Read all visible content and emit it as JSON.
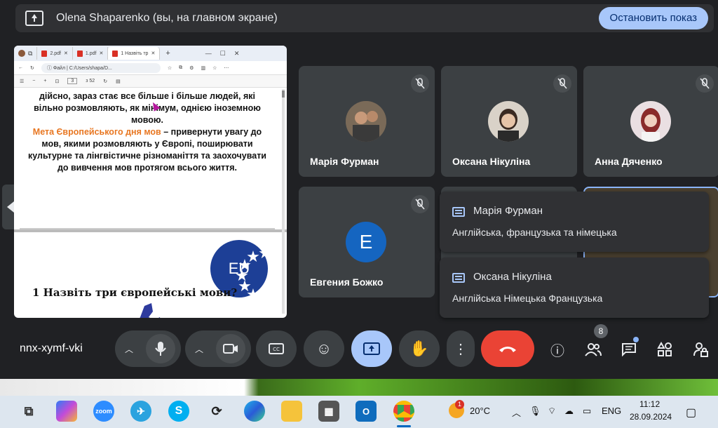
{
  "banner": {
    "title": "Olena Shaparenko (вы, на главном экране)",
    "stop_label": "Остановить показ"
  },
  "presentation": {
    "browser": {
      "tabs": [
        "2.pdf",
        "1.pdf",
        "1 Назвіть тр"
      ],
      "address_label": "Файл",
      "address_path": "C:/Users/shapa/D...",
      "page_current": "3",
      "page_total": "з 52"
    },
    "slide_text": {
      "line1": "дійсно, зараз стає все більше і більше людей, які",
      "line2": "вільно розмовляють, як мінімум, однією іноземною",
      "line3": "мовою.",
      "goal_orange": "Мета Європейського дня мов",
      "goal_rest1": " – привернути увагу до",
      "goal_rest2": "мов, якими розмовляють у Європі, поширювати",
      "goal_rest3": "культурне та лінгвістичне різноманіття та заохочувати",
      "goal_rest4": "до вивчення мов протягом всього життя."
    },
    "flag_text": "EU",
    "question": "1 Назвіть три європейські мови?"
  },
  "participants": [
    {
      "name": "Марія Фурман"
    },
    {
      "name": "Оксана Нікуліна"
    },
    {
      "name": "Анна Дяченко"
    },
    {
      "name": "Евгения Божко",
      "initial": "E"
    }
  ],
  "chats": [
    {
      "sender": "Марія Фурман",
      "message": "Англійська, французька та німецька"
    },
    {
      "sender": "Оксана Нікуліна",
      "message": "Англійська Німецька Французька"
    }
  ],
  "controls": {
    "meeting_code": "nnx-xymf-vki",
    "participant_count": "8"
  },
  "taskbar": {
    "weather_temp": "20°C",
    "weather_badge": "1",
    "language": "ENG",
    "time": "11:12",
    "date": "28.09.2024",
    "zoom_label": "zoom"
  },
  "colors": {
    "meet_bg": "#202124",
    "tile_bg": "#3c4043",
    "accent_blue": "#a8c7fa",
    "end_call_red": "#ea4335",
    "eu_blue": "#1d3f96",
    "slide_orange": "#e87722"
  }
}
